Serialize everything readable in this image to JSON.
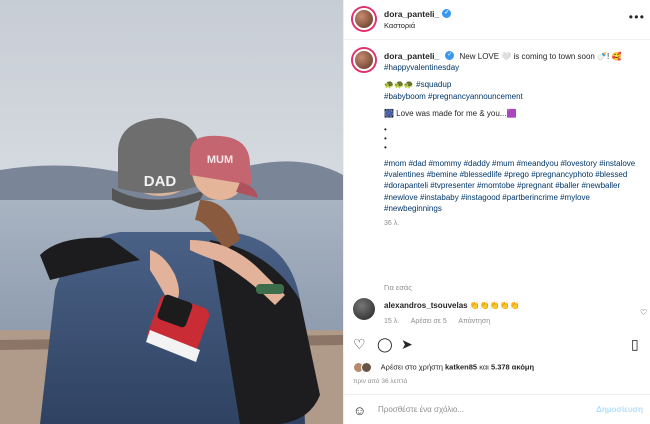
{
  "post": {
    "username": "dora_panteli_",
    "location": "Καστοριά",
    "photo_caps": {
      "left": "DAD",
      "right": "MUM"
    }
  },
  "caption": {
    "username": "dora_panteli_",
    "line1": "New LOVE 🤍 is coming to town soon 🍼! 🥰",
    "line1_tag": "#happyvalentinesday",
    "squad": "🐢🐢🐢",
    "squad_tag": "#squadup",
    "squad_tags2": "#babyboom #pregnancyannouncement",
    "love_line": "🎆 Love was made for me & you...🟪",
    "dots": [
      "•",
      "•",
      "•"
    ],
    "hashtags": "#mom #dad #mommy #daddy #mum #meandyou #lovestory #instalove #valentines #bemine #blessedlife #prego #pregnancyphoto #blessed #dorapanteli #tvpresenter #momtobe #pregnant #baller #newballer #newlove #instababy #instagood #partberincrime #mylove #newbeginnings",
    "time": "36 λ."
  },
  "more_link": "Για εσάς",
  "comment": {
    "username": "alexandros_tsouvelas",
    "text": "👏👏👏👏👏",
    "time": "15 λ.",
    "likes": "Αρέσει σε 5",
    "reply": "Απάντηση"
  },
  "likes": {
    "prefix": "Αρέσει στο χρήστη",
    "user": "katken85",
    "middle": "και",
    "count": "5.378 ακόμη"
  },
  "post_time": "πριν από 36 λεπτά",
  "add_comment": {
    "placeholder": "Προσθέστε ένα σχόλιο...",
    "post": "Δημοσίευση"
  }
}
